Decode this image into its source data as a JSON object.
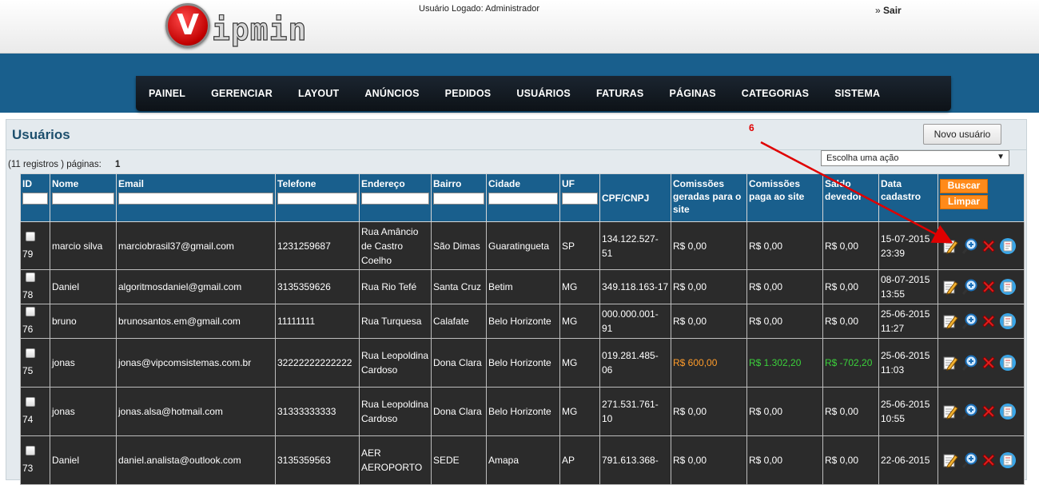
{
  "header": {
    "logo_letter": "V",
    "logo_text": "ipmin",
    "logged_user": "Usuário Logado: Administrador",
    "logout_prefix": "»",
    "logout_label": "Sair"
  },
  "nav": {
    "items": [
      "PAINEL",
      "GERENCIAR",
      "LAYOUT",
      "ANÚNCIOS",
      "PEDIDOS",
      "USUÁRIOS",
      "FATURAS",
      "PÁGINAS",
      "CATEGORIAS",
      "SISTEMA"
    ]
  },
  "panel": {
    "title": "Usuários",
    "new_button": "Novo usuário",
    "action_select": "Escolha uma ação",
    "records_text": "(11 registros ) páginas:",
    "page_number": "1"
  },
  "table": {
    "headers": {
      "id": "ID",
      "nome": "Nome",
      "email": "Email",
      "telefone": "Telefone",
      "endereco": "Endereço",
      "bairro": "Bairro",
      "cidade": "Cidade",
      "uf": "UF",
      "cpf": "CPF/CNPJ",
      "comissoes_geradas": "Comissões geradas para o site",
      "comissoes_paga": "Comissões paga ao site",
      "saldo": "Saldo devedor",
      "data": "Data cadastro"
    },
    "search_button": "Buscar",
    "clear_button": "Limpar",
    "rows": [
      {
        "id": "79",
        "nome": "marcio silva",
        "email": "marciobrasil37@gmail.com",
        "telefone": "1231259687",
        "endereco": "Rua Amâncio de Castro Coelho",
        "bairro": "São Dimas",
        "cidade": "Guaratingueta",
        "uf": "SP",
        "cpf": "134.122.527-51",
        "geradas": "R$ 0,00",
        "paga": "R$ 0,00",
        "saldo": "R$ 0,00",
        "data": "15-07-2015 23:39"
      },
      {
        "id": "78",
        "nome": "Daniel",
        "email": "algoritmosdaniel@gmail.com",
        "telefone": "3135359626",
        "endereco": "Rua Rio Tefé",
        "bairro": "Santa Cruz",
        "cidade": "Betim",
        "uf": "MG",
        "cpf": "349.118.163-17",
        "geradas": "R$ 0,00",
        "paga": "R$ 0,00",
        "saldo": "R$ 0,00",
        "data": "08-07-2015 13:55"
      },
      {
        "id": "76",
        "nome": "bruno",
        "email": "brunosantos.em@gmail.com",
        "telefone": "11111111",
        "endereco": "Rua Turquesa",
        "bairro": "Calafate",
        "cidade": "Belo Horizonte",
        "uf": "MG",
        "cpf": "000.000.001-91",
        "geradas": "R$ 0,00",
        "paga": "R$ 0,00",
        "saldo": "R$ 0,00",
        "data": "25-06-2015 11:27"
      },
      {
        "id": "75",
        "nome": "jonas",
        "email": "jonas@vipcomsistemas.com.br",
        "telefone": "32222222222222",
        "endereco": "Rua Leopoldina Cardoso",
        "bairro": "Dona Clara",
        "cidade": "Belo Horizonte",
        "uf": "MG",
        "cpf": "019.281.485-06",
        "geradas": "R$ 600,00",
        "paga": "R$ 1.302,20",
        "saldo": "R$ -702,20",
        "data": "25-06-2015 11:03"
      },
      {
        "id": "74",
        "nome": "jonas",
        "email": "jonas.alsa@hotmail.com",
        "telefone": "31333333333",
        "endereco": "Rua Leopoldina Cardoso",
        "bairro": "Dona Clara",
        "cidade": "Belo Horizonte",
        "uf": "MG",
        "cpf": "271.531.761-10",
        "geradas": "R$ 0,00",
        "paga": "R$ 0,00",
        "saldo": "R$ 0,00",
        "data": "25-06-2015 10:55"
      },
      {
        "id": "73",
        "nome": "Daniel",
        "email": "daniel.analista@outlook.com",
        "telefone": "3135359563",
        "endereco": "AER AEROPORTO",
        "bairro": "SEDE",
        "cidade": "Amapa",
        "uf": "AP",
        "cpf": "791.613.368-",
        "geradas": "R$ 0,00",
        "paga": "R$ 0,00",
        "saldo": "R$ 0,00",
        "data": "22-06-2015"
      }
    ]
  },
  "annotation": {
    "label": "6",
    "color": "#e00000"
  },
  "colors": {
    "brand_blue": "#195f8d",
    "row_bg": "#2b2b2b",
    "button_orange": "#ff8a1a",
    "positive_green": "#3bd13b",
    "highlight_orange": "#ff9c2a"
  },
  "icons": [
    "edit-icon",
    "view-icon",
    "delete-icon",
    "details-icon"
  ]
}
